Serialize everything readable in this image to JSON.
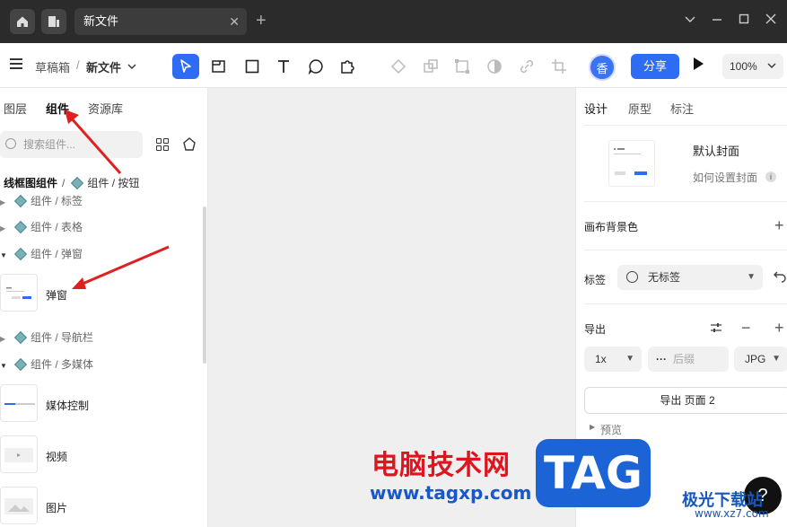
{
  "titlebar": {
    "home_icon": "home-icon",
    "tab_title": "新文件",
    "tab_close": "✕",
    "add_tab": "+"
  },
  "toolbar": {
    "crumb_root": "草稿箱",
    "crumb_sep": "/",
    "crumb_file": "新文件",
    "avatar_label": "香",
    "share_label": "分享",
    "zoom_value": "100%"
  },
  "left_panel": {
    "tabs": [
      {
        "label": "图层",
        "active": false
      },
      {
        "label": "组件",
        "active": true
      },
      {
        "label": "资源库",
        "active": false
      }
    ],
    "search_placeholder": "搜索组件...",
    "path_root": "线框图组件",
    "path_sep": "/",
    "path_leaf": "组件 / 按钮",
    "tree": [
      {
        "label": "组件 / 标签",
        "expanded": false
      },
      {
        "label": "组件 / 表格",
        "expanded": false
      },
      {
        "label": "组件 / 弹窗",
        "expanded": true
      },
      {
        "label": "组件 / 导航栏",
        "expanded": false
      },
      {
        "label": "组件 / 多媒体",
        "expanded": true
      }
    ],
    "items": [
      {
        "label": "弹窗"
      },
      {
        "label": "媒体控制"
      },
      {
        "label": "视频"
      },
      {
        "label": "图片"
      }
    ]
  },
  "right_panel": {
    "tabs": [
      {
        "label": "设计",
        "active": true
      },
      {
        "label": "原型",
        "active": false
      },
      {
        "label": "标注",
        "active": false
      }
    ],
    "cover_title": "默认封面",
    "cover_help": "如何设置封面",
    "canvas_bg_label": "画布背景色",
    "tag_label": "标签",
    "tag_value": "无标签",
    "export_label": "导出",
    "export_scale": "1x",
    "export_suffix_placeholder": "后缀",
    "export_format": "JPG",
    "export_button": "导出 页面 2",
    "preview_label": "预览"
  },
  "watermark": {
    "cn_text": "电脑技术网",
    "url": "www.tagxp.com",
    "tag_text": "TAG",
    "site_name": "极光下载站",
    "site_url": "www.xz7.com"
  },
  "help_label": "?",
  "colors": {
    "accent": "#2f6cf6",
    "arrow": "#e02020",
    "titlebar": "#2b2b2b"
  }
}
